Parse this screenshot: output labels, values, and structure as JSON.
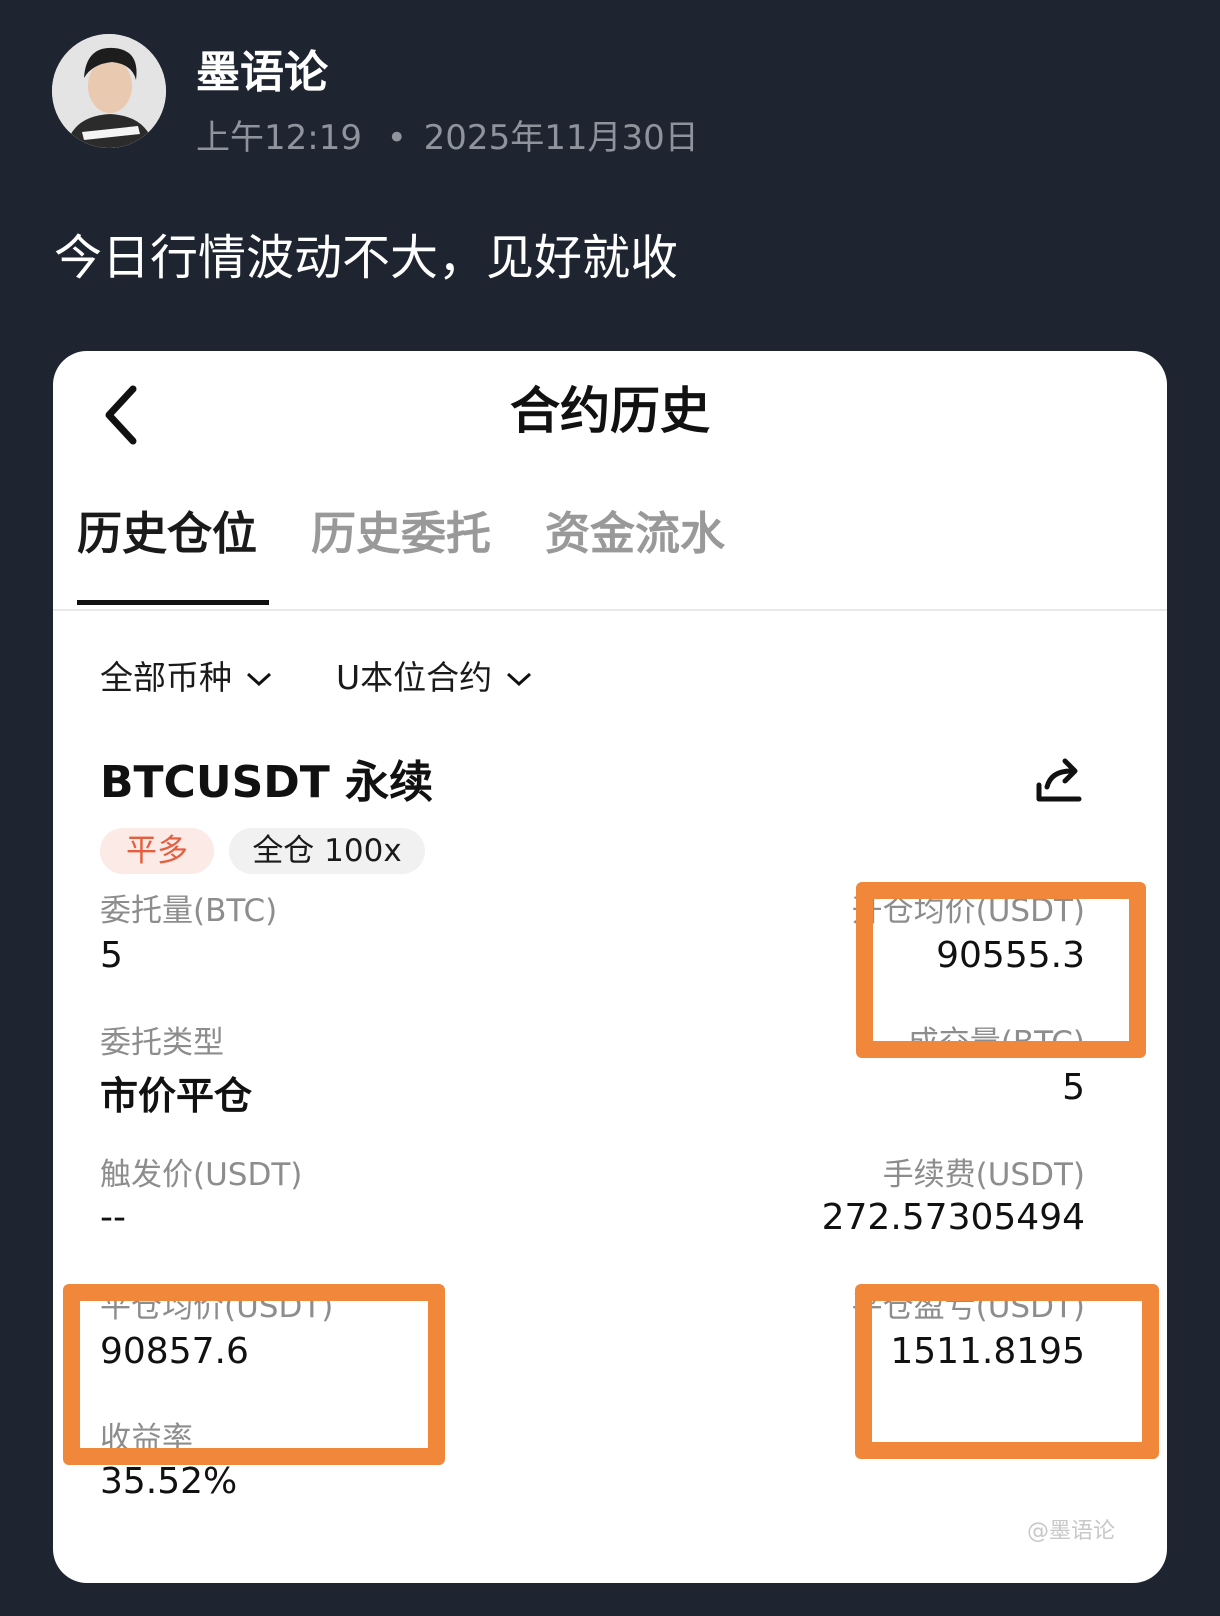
{
  "post": {
    "author": "墨语论",
    "time": "上午12:19",
    "separator": "•",
    "date": "2025年11月30日",
    "text": "今日行情波动不大，见好就收"
  },
  "card": {
    "title": "合约历史",
    "back_icon": "chevron-left-icon",
    "tabs": [
      {
        "label": "历史仓位",
        "active": true
      },
      {
        "label": "历史委托",
        "active": false
      },
      {
        "label": "资金流水",
        "active": false
      }
    ],
    "filters": {
      "coin": "全部币种",
      "contract": "U本位合约"
    },
    "position": {
      "symbol": "BTCUSDT 永续",
      "side_badge": "平多",
      "margin_badge": "全仓 100x",
      "order_qty_label": "委托量(BTC)",
      "order_qty": "5",
      "open_avg_label": "开仓均价(USDT)",
      "open_avg": "90555.3",
      "order_type_label": "委托类型",
      "order_type": "市价平仓",
      "filled_label": "成交量(BTC)",
      "filled": "5",
      "trigger_label": "触发价(USDT)",
      "trigger": "--",
      "fee_label": "手续费(USDT)",
      "fee": "272.57305494",
      "close_avg_label": "平仓均价(USDT)",
      "close_avg": "90857.6",
      "pnl_label": "平仓盈亏(USDT)",
      "pnl": "1511.8195",
      "roi_label": "收益率",
      "roi": "35.52%"
    },
    "watermark": "@墨语论"
  },
  "colors": {
    "background": "#1f2530",
    "highlight": "#f0873a",
    "side_badge_text": "#e55e3f"
  }
}
